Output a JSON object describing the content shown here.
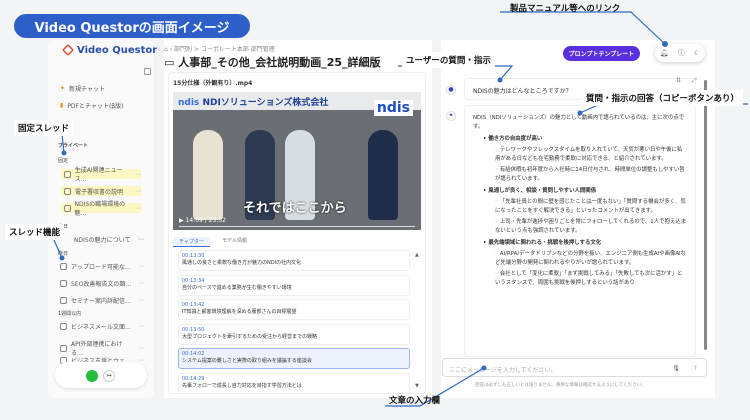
{
  "banner": "Video Questorの画面イメージ",
  "logo": "Video Questor",
  "sidebar": {
    "new_chat": "新規チャット",
    "pdf_chat": "PDFとチャット(β版)",
    "private": "プライベート",
    "pinned": "固定",
    "pinned_items": [
      "生成AI関連ニュース…",
      "電子署収書の説明",
      "NDISの職場環境の魅…"
    ],
    "today": "今日",
    "today_items": [
      "NDISの魅力について"
    ],
    "yesterday": "昨日",
    "yesterday_items": [
      "アップロード可能な…",
      "SEO改善報告文の類…",
      "セミナー案内詳配信…"
    ],
    "week": "1週間以内",
    "week_items": [
      "ビジネスメール文面…",
      "API外部連携における…",
      "ビジネス支援とウェ…"
    ]
  },
  "main": {
    "breadcrumb": "部門別 > コーポレート本部 部門管理",
    "title": "人事部_その他_会社説明動画_25_詳細版",
    "file": "15分仕様（外観有り）.mp4",
    "video_header": "NDIソリューションズ株式会社",
    "video_brand": "ndis",
    "caption": "それではここから",
    "time": "14:09 / 23:32",
    "tabs": [
      "チャプター",
      "モデル情報"
    ],
    "chapters": [
      {
        "t": "00:13:30",
        "d": "風通しの良さと柔軟な働き方が魅力のNDIの社内文化"
      },
      {
        "t": "00:13:34",
        "d": "自分のペースで進める業務が生む働きやすい環境"
      },
      {
        "t": "00:13:42",
        "d": "IT知識と顧客環境理解を深める服部さんの目標展望"
      },
      {
        "t": "00:13:50",
        "d": "大型プロジェクトを牽引するための受注から経営までの戦略"
      },
      {
        "t": "00:14:02",
        "d": "システム提案の難しさと実際の取り組みを議論する座談会"
      },
      {
        "t": "00:14:29",
        "d": "先輩フォローで成長し自力対応を目指す学習方法とは"
      }
    ]
  },
  "chat": {
    "template_button": "プロンプトテンプレート",
    "question": "NDISの魅力はどんなところですか？",
    "intro": "NDIS（NDIソリューションズ）の魅力として動画内で語られているのは、主に次の点です。",
    "points": [
      {
        "h": "働き方の自由度が高い",
        "s": [
          "テレワークやフレックスタイムを取り入れていて、天気が悪い日や午後に私用がある日なども在宅勤務で柔軟に対応できる、と紹介されています。",
          "有給休暇も初年度から入社時に14日付与され、時間単位の調整もしやすい旨が語られています。"
        ]
      },
      {
        "h": "風通しが良く、相談・質問しやすい人間関係",
        "s": [
          "「先輩社員との間に壁を感じたことは一度もない」「質問する機会が多く、気になったことをすぐ解決できる」といったコメントが出てきます。",
          "上司・先輩が進捗や困りごとを常にフォローしてくれるので、1人で抱え込まないという点も強調されています。"
        ]
      },
      {
        "h": "最先端領域に関われる・挑戦を後押しする文化",
        "s": [
          "AI/RPA/データドリブンなどの分野を扱い、エンジニア側も生成AIや画像AIなど先端分野の開発に関われるやりがいが語られています。",
          "会社として「変化に柔軟」「まず挑戦してみる」「失敗しても次に活かす」というスタンスで、周囲も挑戦を後押しするという話があり"
        ]
      }
    ],
    "input_placeholder": "ここにメッセージを入力してください。",
    "disclaimer": "回答は必ずしも正しいとは限りません。重要な情報は確認するようにしてください。"
  },
  "callouts": {
    "pinned_thread": "固定スレッド",
    "thread_feature": "スレッド機能",
    "user_question": "ユーザーの質問・指示",
    "manual_link": "製品マニュアル等へのリンク",
    "answer": "質問・指示の回答（コピーボタンあり）",
    "input_field": "文章の入力欄"
  },
  "colors": {
    "accent": "#2e5fc9",
    "template": "#5a2fe0",
    "pinned_bg": "#fdf7c3"
  }
}
